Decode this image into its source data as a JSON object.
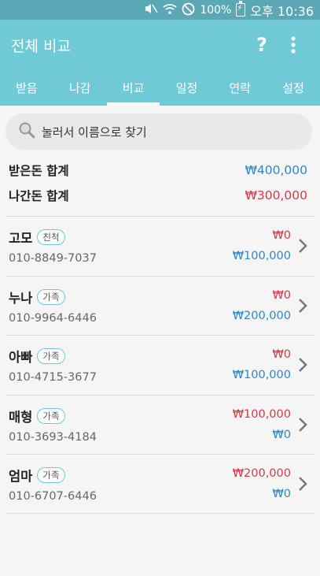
{
  "status_bar": {
    "battery_text": "100%",
    "time": "오후 10:36"
  },
  "app_bar": {
    "title": "전체 비교",
    "help_icon": "question-icon",
    "menu_icon": "more-vert-icon"
  },
  "tabs": [
    {
      "label": "받음",
      "active": false
    },
    {
      "label": "나감",
      "active": false
    },
    {
      "label": "비교",
      "active": true
    },
    {
      "label": "일정",
      "active": false
    },
    {
      "label": "연락",
      "active": false
    },
    {
      "label": "설정",
      "active": false
    }
  ],
  "search": {
    "placeholder": "눌러서 이름으로 찾기"
  },
  "summary": {
    "received_label": "받은돈 합계",
    "received_value": "₩400,000",
    "sent_label": "나간돈 합계",
    "sent_value": "₩300,000"
  },
  "contacts": [
    {
      "name": "고모",
      "tag": "친척",
      "phone": "010-8849-7037",
      "sent": "₩0",
      "received": "₩100,000"
    },
    {
      "name": "누나",
      "tag": "가족",
      "phone": "010-9964-6446",
      "sent": "₩0",
      "received": "₩200,000"
    },
    {
      "name": "아빠",
      "tag": "가족",
      "phone": "010-4715-3677",
      "sent": "₩0",
      "received": "₩100,000"
    },
    {
      "name": "매형",
      "tag": "가족",
      "phone": "010-3693-4184",
      "sent": "₩100,000",
      "received": "₩0"
    },
    {
      "name": "엄마",
      "tag": "가족",
      "phone": "010-6707-6446",
      "sent": "₩200,000",
      "received": "₩0"
    }
  ],
  "colors": {
    "primary": "#6fcad6",
    "status_bar": "#5aa7b5",
    "received_blue": "#2f86c9",
    "sent_red": "#cf3b4b"
  }
}
